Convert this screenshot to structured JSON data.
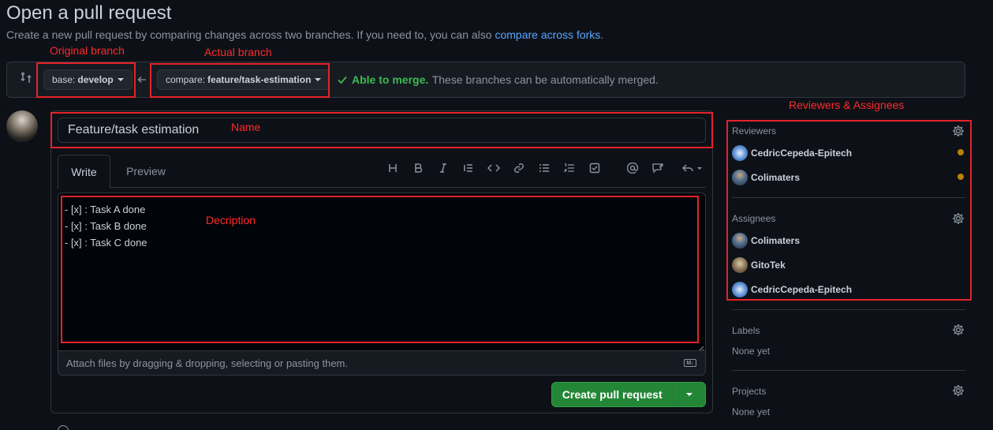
{
  "page": {
    "title": "Open a pull request",
    "subtitle_prefix": "Create a new pull request by comparing changes across two branches. If you need to, you can also ",
    "subtitle_link": "compare across forks",
    "subtitle_suffix": "."
  },
  "branches": {
    "base_prefix": "base:",
    "base_value": "develop",
    "compare_prefix": "compare:",
    "compare_value": "feature/task-estimation",
    "merge_status": "Able to merge.",
    "merge_detail": "These branches can be automatically merged."
  },
  "annotations": {
    "original_branch": "Original branch",
    "actual_branch": "Actual branch",
    "name": "Name",
    "description": "Decription",
    "reviewers_assignees": "Reviewers & Assignees"
  },
  "form": {
    "title_value": "Feature/task estimation",
    "tabs": {
      "write": "Write",
      "preview": "Preview"
    },
    "toolbar": [
      "heading-icon",
      "bold-icon",
      "italic-icon",
      "quote-icon",
      "code-icon",
      "link-icon",
      "bulleted-list-icon",
      "numbered-list-icon",
      "task-list-icon",
      "mention-icon",
      "reference-icon",
      "reply-icon"
    ],
    "description_lines": [
      "- [x] : Task A done",
      "- [x] : Task B done",
      "- [x] : Task C done"
    ],
    "attach_text": "Attach files by dragging & dropping, selecting or pasting them.",
    "markdown_badge": "M↓",
    "submit_label": "Create pull request"
  },
  "sidebar": {
    "reviewers": {
      "label": "Reviewers",
      "people": [
        {
          "name": "CedricCepeda-Epitech",
          "pending": true
        },
        {
          "name": "Colimaters",
          "pending": true
        }
      ]
    },
    "assignees": {
      "label": "Assignees",
      "people": [
        {
          "name": "Colimaters"
        },
        {
          "name": "GitoTek"
        },
        {
          "name": "CedricCepeda-Epitech"
        }
      ]
    },
    "labels": {
      "label": "Labels",
      "value": "None yet"
    },
    "projects": {
      "label": "Projects",
      "value": "None yet"
    }
  },
  "colors": {
    "accent_link": "#58a6ff",
    "success": "#3fb950",
    "primary_button": "#238636",
    "annotation": "#e5222a",
    "pending_dot": "#bb8009"
  }
}
